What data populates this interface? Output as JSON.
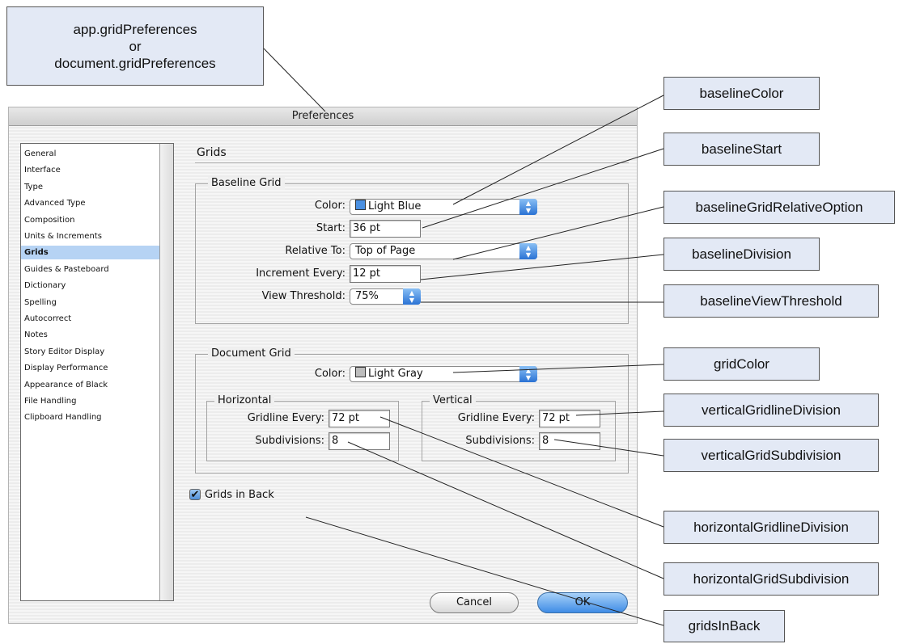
{
  "callouts": {
    "top": [
      "app.gridPreferences",
      "or",
      "document.gridPreferences"
    ],
    "baselineColor": "baselineColor",
    "baselineStart": "baselineStart",
    "baselineGridRelativeOption": "baselineGridRelativeOption",
    "baselineDivision": "baselineDivision",
    "baselineViewThreshold": "baselineViewThreshold",
    "gridColor": "gridColor",
    "verticalGridlineDivision": "verticalGridlineDivision",
    "verticalGridSubdivision": "verticalGridSubdivision",
    "horizontalGridlineDivision": "horizontalGridlineDivision",
    "horizontalGridSubdivision": "horizontalGridSubdivision",
    "gridsInBack": "gridsInBack"
  },
  "dialog": {
    "title": "Preferences",
    "sidebar": [
      "General",
      "Interface",
      "Type",
      "Advanced Type",
      "Composition",
      "Units & Increments",
      "Grids",
      "Guides & Pasteboard",
      "Dictionary",
      "Spelling",
      "Autocorrect",
      "Notes",
      "Story Editor Display",
      "Display Performance",
      "Appearance of Black",
      "File Handling",
      "Clipboard Handling"
    ],
    "selected": "Grids",
    "section_title": "Grids",
    "baseline_grid": {
      "title": "Baseline Grid",
      "color_label": "Color:",
      "color_value": "Light Blue",
      "color_swatch": "#4a90e2",
      "start_label": "Start:",
      "start_value": "36 pt",
      "relative_label": "Relative To:",
      "relative_value": "Top of Page",
      "increment_label": "Increment Every:",
      "increment_value": "12 pt",
      "threshold_label": "View Threshold:",
      "threshold_value": "75%"
    },
    "document_grid": {
      "title": "Document Grid",
      "color_label": "Color:",
      "color_value": "Light Gray",
      "color_swatch": "#bdbdbd",
      "horizontal": {
        "title": "Horizontal",
        "gridline_label": "Gridline Every:",
        "gridline_value": "72 pt",
        "subdivisions_label": "Subdivisions:",
        "subdivisions_value": "8"
      },
      "vertical": {
        "title": "Vertical",
        "gridline_label": "Gridline Every:",
        "gridline_value": "72 pt",
        "subdivisions_label": "Subdivisions:",
        "subdivisions_value": "8"
      }
    },
    "grids_in_back": {
      "label": "Grids in Back",
      "checked": true
    },
    "buttons": {
      "cancel": "Cancel",
      "ok": "OK"
    }
  }
}
